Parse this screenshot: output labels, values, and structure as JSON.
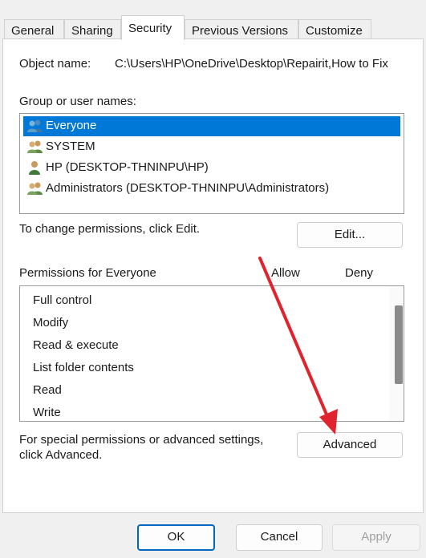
{
  "tabs": [
    {
      "label": "General"
    },
    {
      "label": "Sharing"
    },
    {
      "label": "Security"
    },
    {
      "label": "Previous Versions"
    },
    {
      "label": "Customize"
    }
  ],
  "active_tab": "Security",
  "object_name": {
    "label": "Object name:",
    "value": "C:\\Users\\HP\\OneDrive\\Desktop\\Repairit,How to Fix"
  },
  "group_users": {
    "label": "Group or user names:",
    "items": [
      {
        "name": "Everyone",
        "icon": "group-users-icon",
        "selected": true
      },
      {
        "name": "SYSTEM",
        "icon": "group-users-icon",
        "selected": false
      },
      {
        "name": "HP (DESKTOP-THNINPU\\HP)",
        "icon": "user-icon",
        "selected": false
      },
      {
        "name": "Administrators (DESKTOP-THNINPU\\Administrators)",
        "icon": "group-users-icon",
        "selected": false
      }
    ]
  },
  "change_permissions": {
    "text": "To change permissions, click Edit.",
    "edit_button": "Edit..."
  },
  "permissions": {
    "title": "Permissions for Everyone",
    "allow_header": "Allow",
    "deny_header": "Deny",
    "items": [
      "Full control",
      "Modify",
      "Read & execute",
      "List folder contents",
      "Read",
      "Write"
    ]
  },
  "special": {
    "text_line1": "For special permissions or advanced settings,",
    "text_line2": "click Advanced.",
    "advanced_button": "Advanced"
  },
  "footer": {
    "ok": "OK",
    "cancel": "Cancel",
    "apply": "Apply"
  },
  "colors": {
    "selection": "#0078d7",
    "annotation_arrow": "#e0242e",
    "primary_border": "#0067c0"
  }
}
